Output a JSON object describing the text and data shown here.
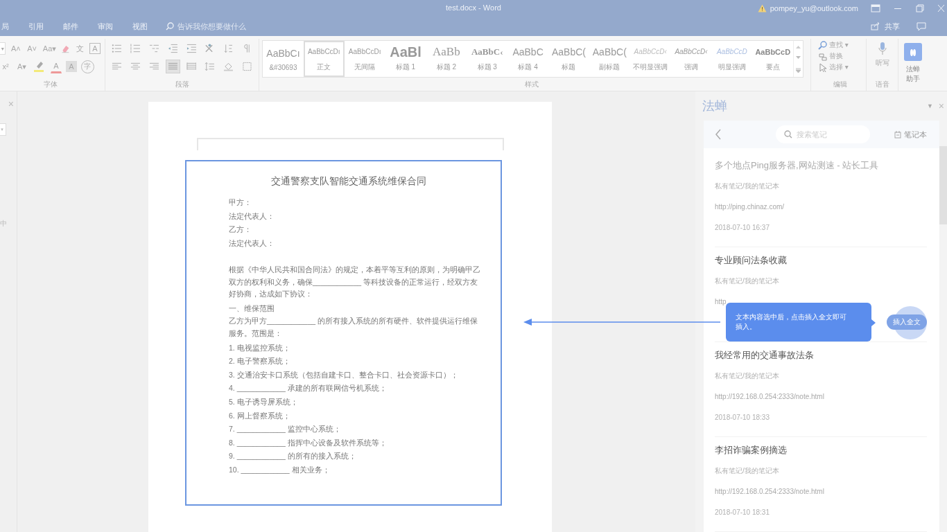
{
  "window": {
    "title": "test.docx - Word",
    "account": "pompey_yu@outlook.com"
  },
  "menu": {
    "tabs": [
      "局",
      "引用",
      "邮件",
      "审阅",
      "视图"
    ],
    "tell_me": "告诉我你想要做什么",
    "share": "共享"
  },
  "ribbon": {
    "font": {
      "label": "字体",
      "row1": [
        {
          "kind": "dropdown",
          "text": "▾"
        },
        {
          "kind": "glyph",
          "text": "A˄"
        },
        {
          "kind": "glyph",
          "text": "A˅"
        },
        {
          "kind": "glyph",
          "text": "Aa▾"
        },
        {
          "kind": "eraser"
        },
        {
          "kind": "glyph",
          "text": "文"
        },
        {
          "kind": "boxed",
          "text": "A"
        }
      ],
      "row2": [
        {
          "kind": "glyph",
          "text": "x²"
        },
        {
          "kind": "glyph",
          "text": "A▾"
        },
        {
          "kind": "highlight"
        },
        {
          "kind": "fontcolor",
          "text": "A"
        },
        {
          "kind": "shaded",
          "text": "A"
        },
        {
          "kind": "circled",
          "text": "字"
        }
      ]
    },
    "paragraph": {
      "label": "段落",
      "row1": [
        {
          "kind": "bullets",
          "selected": false
        },
        {
          "kind": "numbering",
          "selected": false
        },
        {
          "kind": "multilevel",
          "selected": false
        },
        {
          "kind": "outdent",
          "selected": false
        },
        {
          "kind": "indent",
          "selected": false
        },
        {
          "kind": "layout",
          "selected": false
        },
        {
          "kind": "sort",
          "selected": false
        },
        {
          "kind": "marks",
          "selected": false
        }
      ],
      "row2": [
        {
          "kind": "align-left",
          "selected": false
        },
        {
          "kind": "align-center",
          "selected": false
        },
        {
          "kind": "align-right",
          "selected": false
        },
        {
          "kind": "justify",
          "selected": true
        },
        {
          "kind": "distribute",
          "selected": false
        },
        {
          "kind": "line-spacing",
          "selected": false
        },
        {
          "kind": "shading",
          "selected": false
        },
        {
          "kind": "borders",
          "selected": false
        }
      ]
    },
    "styles": {
      "label": "样式",
      "items": [
        {
          "preview": "AaBbCı",
          "name": "&#30693",
          "kind": "normal",
          "selected": false
        },
        {
          "preview": "AaBbCcDı",
          "name": "正文",
          "kind": "small",
          "selected": true
        },
        {
          "preview": "AaBbCcDı",
          "name": "无间隔",
          "kind": "small",
          "selected": false
        },
        {
          "preview": "AaBl",
          "name": "标题 1",
          "kind": "heading1",
          "selected": false
        },
        {
          "preview": "AaBb",
          "name": "标题 2",
          "kind": "heading2",
          "selected": false
        },
        {
          "preview": "AaBbC‹",
          "name": "标题 3",
          "kind": "heading3",
          "selected": false
        },
        {
          "preview": "AaBbC",
          "name": "标题 4",
          "kind": "normal",
          "selected": false
        },
        {
          "preview": "AaBbC(",
          "name": "标题",
          "kind": "normal",
          "selected": false
        },
        {
          "preview": "AaBbC(",
          "name": "副标题",
          "kind": "normal",
          "selected": false
        },
        {
          "preview": "AaBbCcD‹",
          "name": "不明显强调",
          "kind": "subtle",
          "selected": false
        },
        {
          "preview": "AaBbCcD‹",
          "name": "强调",
          "kind": "emphasis",
          "selected": false
        },
        {
          "preview": "AaBbCcD",
          "name": "明显强调",
          "kind": "intense",
          "selected": false
        },
        {
          "preview": "AaBbCcD",
          "name": "要点",
          "kind": "strong",
          "selected": false
        }
      ]
    },
    "editing": {
      "label": "编辑",
      "items": [
        {
          "kind": "find",
          "label": "查找 ▾"
        },
        {
          "kind": "replace",
          "label": "替换"
        },
        {
          "kind": "select",
          "label": "选择 ▾"
        }
      ]
    },
    "voice": {
      "label": "语音",
      "button": "听写"
    },
    "addin": {
      "label": [
        "法蝉",
        "助手"
      ]
    }
  },
  "left_pane": {
    "close": "×",
    "dropdown": "▾",
    "fragment": "中"
  },
  "document": {
    "paragraphs": [
      {
        "kind": "title",
        "text": "交通警察支队智能交通系统维保合同"
      },
      {
        "kind": "line",
        "text": "甲方："
      },
      {
        "kind": "line",
        "text": "法定代表人："
      },
      {
        "kind": "line",
        "text": "乙方："
      },
      {
        "kind": "line",
        "text": "法定代表人："
      },
      {
        "kind": "blank"
      },
      {
        "kind": "para",
        "text": "根据《中华人民共和国合同法》的规定，本着平等互利的原则，为明确甲乙双方的权利和义务，确保____________ 等科技设备的正常运行，经双方友好协商，达成如下协议："
      },
      {
        "kind": "heading",
        "text": "一、维保范围"
      },
      {
        "kind": "para",
        "text": "乙方为甲方____________ 的所有接入系统的所有硬件、软件提供运行维保服务。范围是："
      },
      {
        "kind": "line",
        "text": "1. 电视监控系统；"
      },
      {
        "kind": "line",
        "text": "2. 电子警察系统；"
      },
      {
        "kind": "line",
        "text": "3. 交通治安卡口系统（包括自建卡口、整合卡口、社会资源卡口）；"
      },
      {
        "kind": "line",
        "text": "4. ____________ 承建的所有联网信号机系统；"
      },
      {
        "kind": "line",
        "text": "5. 电子诱导屏系统；"
      },
      {
        "kind": "line",
        "text": "6. 网上督察系统；"
      },
      {
        "kind": "line",
        "text": "7. ____________ 监控中心系统；"
      },
      {
        "kind": "line",
        "text": "8. ____________ 指挥中心设备及软件系统等；"
      },
      {
        "kind": "line",
        "text": "9. ____________ 的所有的接入系统；"
      },
      {
        "kind": "line",
        "text": "10. ____________ 相关业务；"
      }
    ]
  },
  "panel": {
    "title": "法蝉",
    "caret": "▼",
    "close": "×",
    "search": {
      "placeholder": "搜索笔记"
    },
    "notebook": "笔记本",
    "notes": [
      {
        "title": "多个地点Ping服务器,网站测速 - 站长工具",
        "faded": true,
        "path": "私有笔记/我的笔记本",
        "url": "http://ping.chinaz.com/",
        "date": "2018-07-10 16:37"
      },
      {
        "title": "专业顾问法条收藏",
        "faded": false,
        "path": "私有笔记/我的笔记本",
        "url": "http"
      },
      {
        "title": "我经常用的交通事故法条",
        "faded": false,
        "path": "私有笔记/我的笔记本",
        "url": "http://192.168.0.254:2333/note.html",
        "date": "2018-07-10 18:33"
      },
      {
        "title": "李招诈骗案例摘选",
        "faded": false,
        "path": "私有笔记/我的笔记本",
        "url": "http://192.168.0.254:2333/note.html",
        "date": "2018-07-10 18:31"
      }
    ],
    "tooltip": "文本内容选中后，点击插入全文即可插入。",
    "insert_button": "插入全文"
  }
}
